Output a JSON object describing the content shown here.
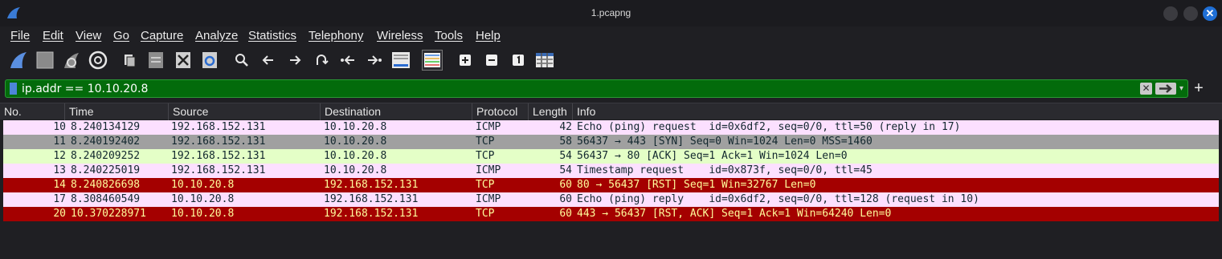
{
  "window": {
    "title": "1.pcapng"
  },
  "menu": [
    "File",
    "Edit",
    "View",
    "Go",
    "Capture",
    "Analyze",
    "Statistics",
    "Telephony",
    "Wireless",
    "Tools",
    "Help"
  ],
  "toolbar": [
    "start-capture-icon",
    "stop-capture-icon",
    "restart-capture-icon",
    "capture-options-icon",
    "open-file-icon",
    "save-file-icon",
    "close-file-icon",
    "reload-file-icon",
    "find-packet-icon",
    "go-back-icon",
    "go-forward-icon",
    "go-to-packet-icon",
    "go-first-icon",
    "go-last-icon",
    "autoscroll-icon",
    "colorize-icon",
    "zoom-in-icon",
    "zoom-out-icon",
    "normal-size-icon",
    "resize-columns-icon"
  ],
  "filter": {
    "value": "ip.addr == 10.10.20.8",
    "color": "#036b0b"
  },
  "columns": [
    "No.",
    "Time",
    "Source",
    "Destination",
    "Protocol",
    "Length",
    "Info"
  ],
  "packets": [
    {
      "no": "10",
      "time": "8.240134129",
      "src": "192.168.152.131",
      "dst": "10.10.20.8",
      "proto": "ICMP",
      "len": "42",
      "info": "Echo (ping) request  id=0x6df2, seq=0/0, ttl=50 (reply in 17)",
      "bg": "#fce0ff",
      "fg": "#12272e"
    },
    {
      "no": "11",
      "time": "8.240192402",
      "src": "192.168.152.131",
      "dst": "10.10.20.8",
      "proto": "TCP",
      "len": "58",
      "info": "56437 → 443 [SYN] Seq=0 Win=1024 Len=0 MSS=1460",
      "bg": "#a0a0a0",
      "fg": "#12272e"
    },
    {
      "no": "12",
      "time": "8.240209252",
      "src": "192.168.152.131",
      "dst": "10.10.20.8",
      "proto": "TCP",
      "len": "54",
      "info": "56437 → 80 [ACK] Seq=1 Ack=1 Win=1024 Len=0",
      "bg": "#e4ffc7",
      "fg": "#12272e"
    },
    {
      "no": "13",
      "time": "8.240225019",
      "src": "192.168.152.131",
      "dst": "10.10.20.8",
      "proto": "ICMP",
      "len": "54",
      "info": "Timestamp request    id=0x873f, seq=0/0, ttl=45",
      "bg": "#fce0ff",
      "fg": "#12272e"
    },
    {
      "no": "14",
      "time": "8.240826698",
      "src": "10.10.20.8",
      "dst": "192.168.152.131",
      "proto": "TCP",
      "len": "60",
      "info": "80 → 56437 [RST] Seq=1 Win=32767 Len=0",
      "bg": "#a40000",
      "fg": "#fffc9c"
    },
    {
      "no": "17",
      "time": "8.308460549",
      "src": "10.10.20.8",
      "dst": "192.168.152.131",
      "proto": "ICMP",
      "len": "60",
      "info": "Echo (ping) reply    id=0x6df2, seq=0/0, ttl=128 (request in 10)",
      "bg": "#fce0ff",
      "fg": "#12272e"
    },
    {
      "no": "20",
      "time": "10.370228971",
      "src": "10.10.20.8",
      "dst": "192.168.152.131",
      "proto": "TCP",
      "len": "60",
      "info": "443 → 56437 [RST, ACK] Seq=1 Ack=1 Win=64240 Len=0",
      "bg": "#a40000",
      "fg": "#fffc9c"
    }
  ]
}
